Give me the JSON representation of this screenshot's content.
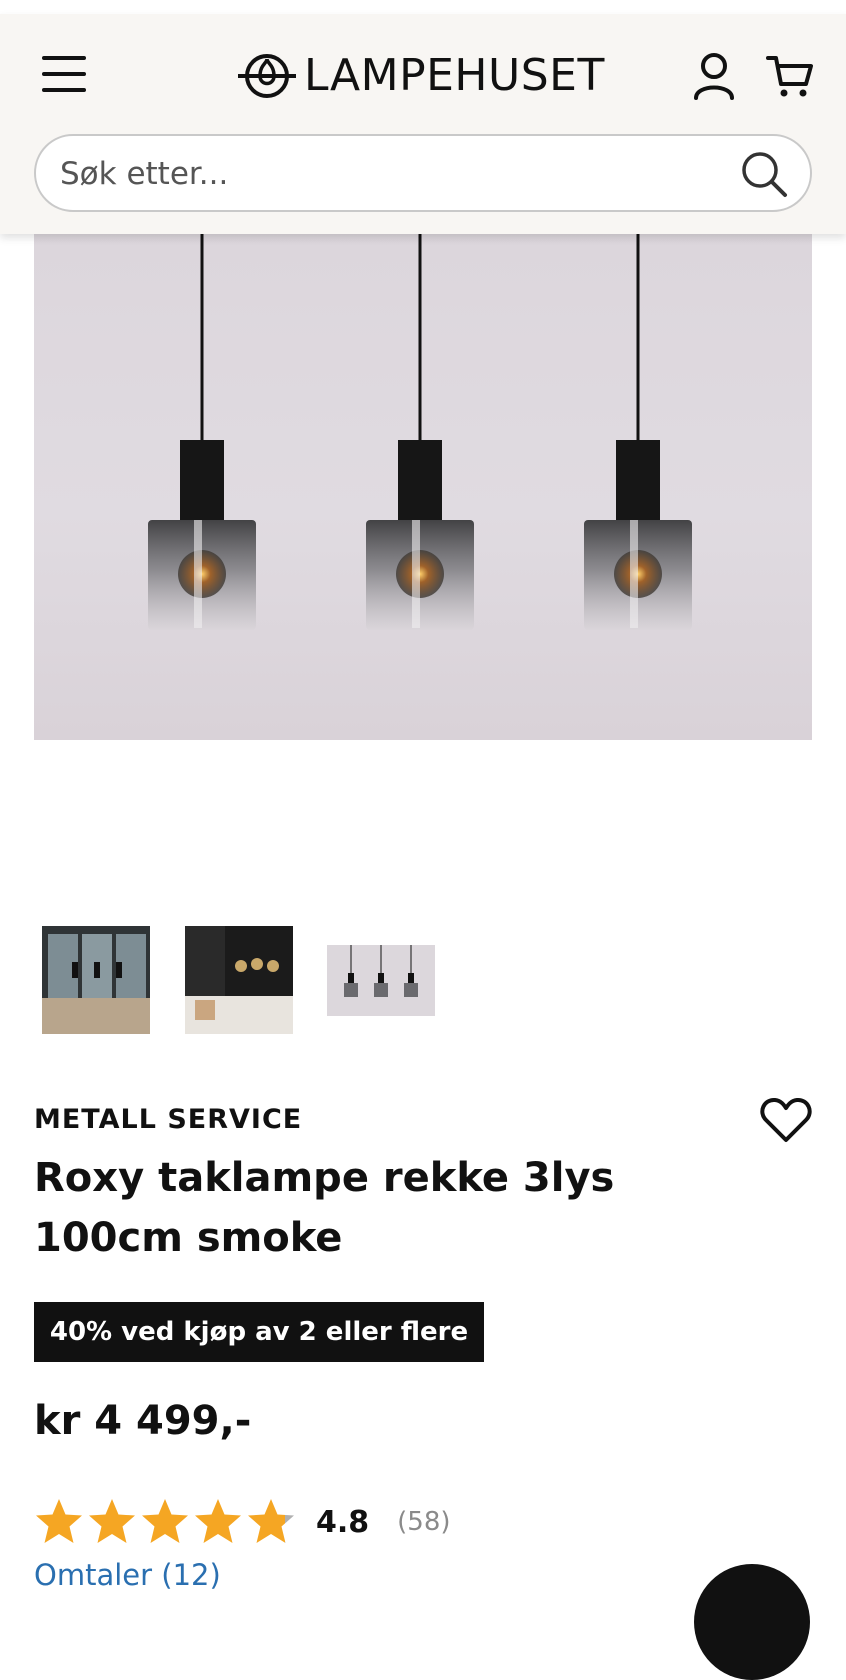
{
  "header": {
    "logo_text": "LAMPEHUSET",
    "menu_icon": "hamburger-menu-icon",
    "account_icon": "user-icon",
    "cart_icon": "cart-icon"
  },
  "search": {
    "placeholder": "Søk etter...",
    "value": "",
    "icon": "search-icon"
  },
  "gallery": {
    "thumbnails": [
      "thumbnail-dining-room",
      "thumbnail-kitchen",
      "thumbnail-product"
    ]
  },
  "product": {
    "brand": "METALL SERVICE",
    "title": "Roxy taklampe rekke 3lys 100cm smoke",
    "promo": "40% ved kjøp av 2 eller flere",
    "price": "kr 4 499,-",
    "rating": 4.8,
    "rating_label": "4.8",
    "rating_count": "(58)",
    "reviews_link": "Omtaler (12)"
  },
  "colors": {
    "header_bg": "#f8f6f3",
    "star": "#f5a623",
    "star_empty": "#b0b0b0",
    "link": "#2a6fb0",
    "promo_bg": "#111111"
  }
}
